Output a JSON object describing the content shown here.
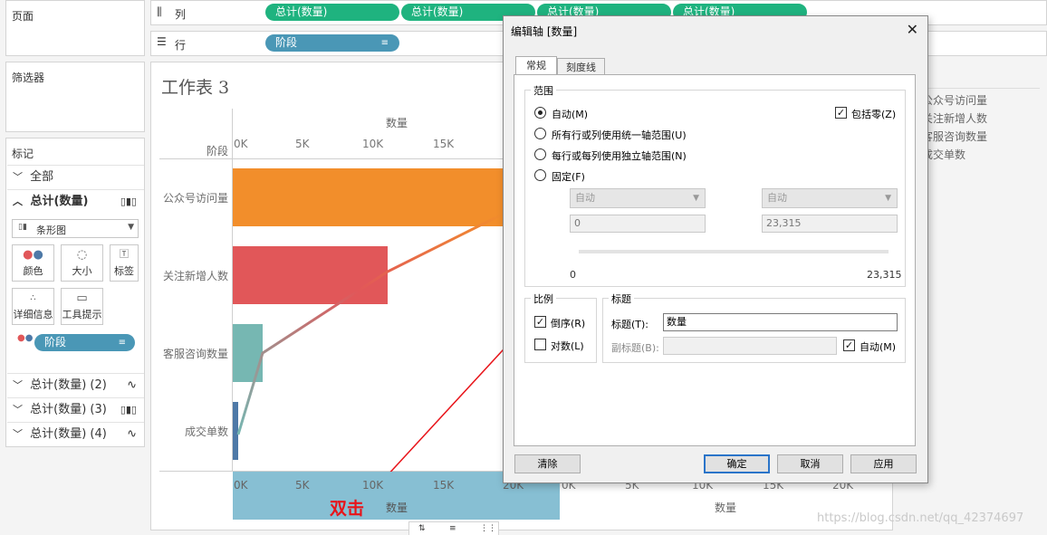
{
  "left_panel": {
    "pages_title": "页面",
    "filters_title": "筛选器",
    "marks_title": "标记",
    "marks_rows": [
      {
        "label": "全部"
      },
      {
        "label": "总计(数量)"
      }
    ],
    "mark_type": "条形图",
    "mark_buttons": [
      "颜色",
      "大小",
      "标签",
      "详细信息",
      "工具提示"
    ],
    "mark_pill": "阶段",
    "extra_measures": [
      "总计(数量) (2)",
      "总计(数量) (3)",
      "总计(数量) (4)"
    ]
  },
  "shelves": {
    "columns_label": "列",
    "rows_label": "行",
    "column_pills": [
      "总计(数量)",
      "总计(数量)",
      "总计(数量)",
      "总计(数量)"
    ],
    "row_pill": "阶段"
  },
  "worksheet": {
    "title": "工作表 3",
    "stage_header": "阶段",
    "top_axis_title": "数量",
    "top_ticks": [
      "0K",
      "5K",
      "10K",
      "15K"
    ],
    "bottom_ticks_left": [
      "0K",
      "5K",
      "10K",
      "15K",
      "20K"
    ],
    "bottom_ticks_right": [
      "0K",
      "5K",
      "10K",
      "15K",
      "20K"
    ],
    "bottom_axis_title_left": "数量",
    "bottom_axis_title_right": "数量"
  },
  "legend": {
    "items": [
      "公众号访问量",
      "关注新增人数",
      "客服咨询数量",
      "成交单数"
    ]
  },
  "chart_data": {
    "type": "bar",
    "orientation": "horizontal",
    "categories": [
      "公众号访问量",
      "关注新增人数",
      "客服咨询数量",
      "成交单数"
    ],
    "values": [
      23315,
      11000,
      2100,
      400
    ],
    "colors": [
      "#f28e2b",
      "#e15759",
      "#76b7b2",
      "#4e79a7"
    ],
    "xlabel": "数量",
    "ylabel": "阶段",
    "xlim": [
      0,
      23315
    ]
  },
  "annotation": {
    "label": "双击",
    "color": "#e8141a"
  },
  "dialog": {
    "title": "编辑轴 [数量]",
    "tabs": [
      "常规",
      "刻度线"
    ],
    "range_group": "范围",
    "range_options": [
      "自动(M)",
      "所有行或列使用统一轴范围(U)",
      "每行或每列使用独立轴范围(N)",
      "固定(F)"
    ],
    "include_zero": "包括零(Z)",
    "fixed_start_dd": "自动",
    "fixed_end_dd": "自动",
    "fixed_start_value": "0",
    "fixed_end_value": "23,315",
    "slider_min": "0",
    "slider_max": "23,315",
    "scale_group": "比例",
    "reversed": "倒序(R)",
    "log": "对数(L)",
    "title_group": "标题",
    "title_label": "标题(T):",
    "title_value": "数量",
    "subtitle_label": "副标题(B):",
    "subtitle_auto": "自动(M)",
    "buttons": {
      "clear": "清除",
      "ok": "确定",
      "cancel": "取消",
      "apply": "应用"
    }
  },
  "watermark": "https://blog.csdn.net/qq_42374697"
}
